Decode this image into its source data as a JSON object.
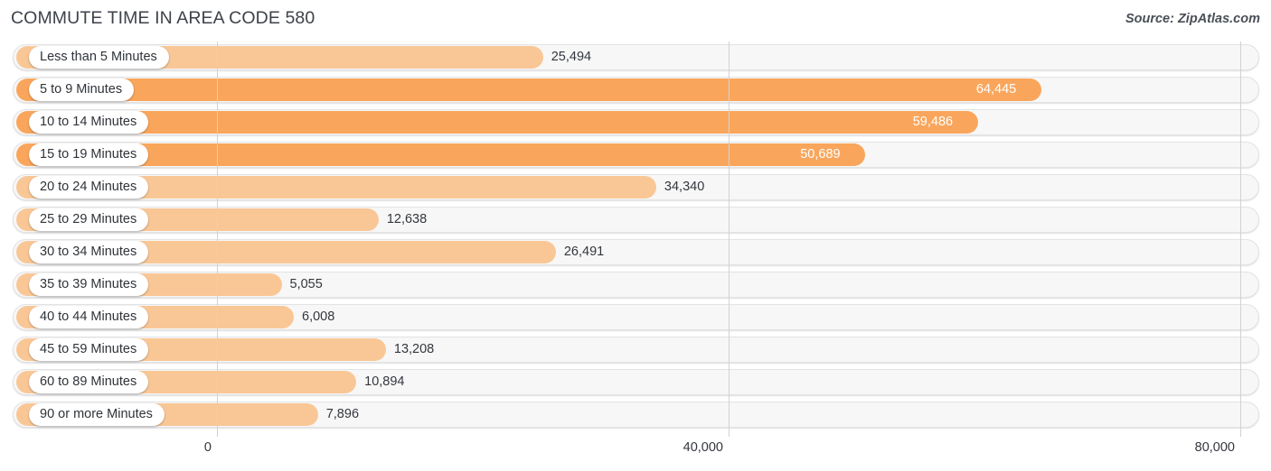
{
  "header": {
    "title": "COMMUTE TIME IN AREA CODE 580",
    "source": "Source: ZipAtlas.com"
  },
  "colors": {
    "bar_dark": "#f9a65c",
    "bar_light": "#f9c796",
    "track_fill": "#f7f7f7",
    "track_border": "#e3e3e3",
    "gridline": "#d2d2d2",
    "value_text_outside": "#33373d",
    "value_text_inside": "#ffffff",
    "title_text": "#3d4249"
  },
  "chart_data": {
    "type": "bar",
    "orientation": "horizontal",
    "title": "COMMUTE TIME IN AREA CODE 580",
    "xlabel": "",
    "ylabel": "",
    "xlim": [
      0,
      80000
    ],
    "grid": true,
    "legend": null,
    "xticks": [
      0,
      40000,
      80000
    ],
    "xtick_labels": [
      "0",
      "40,000",
      "80,000"
    ],
    "categories": [
      "Less than 5 Minutes",
      "5 to 9 Minutes",
      "10 to 14 Minutes",
      "15 to 19 Minutes",
      "20 to 24 Minutes",
      "25 to 29 Minutes",
      "30 to 34 Minutes",
      "35 to 39 Minutes",
      "40 to 44 Minutes",
      "45 to 59 Minutes",
      "60 to 89 Minutes",
      "90 or more Minutes"
    ],
    "values": [
      25494,
      64445,
      59486,
      50689,
      34340,
      12638,
      26491,
      5055,
      6008,
      13208,
      10894,
      7896
    ],
    "value_labels": [
      "25,494",
      "64,445",
      "59,486",
      "50,689",
      "34,340",
      "12,638",
      "26,491",
      "5,055",
      "6,008",
      "13,208",
      "10,894",
      "7,896"
    ],
    "bar_shades": [
      "light",
      "dark",
      "dark",
      "dark",
      "light",
      "light",
      "light",
      "light",
      "light",
      "light",
      "light",
      "light"
    ],
    "label_placement": [
      "outside",
      "inside",
      "inside",
      "inside",
      "outside",
      "outside",
      "outside",
      "outside",
      "outside",
      "outside",
      "outside",
      "outside"
    ]
  }
}
